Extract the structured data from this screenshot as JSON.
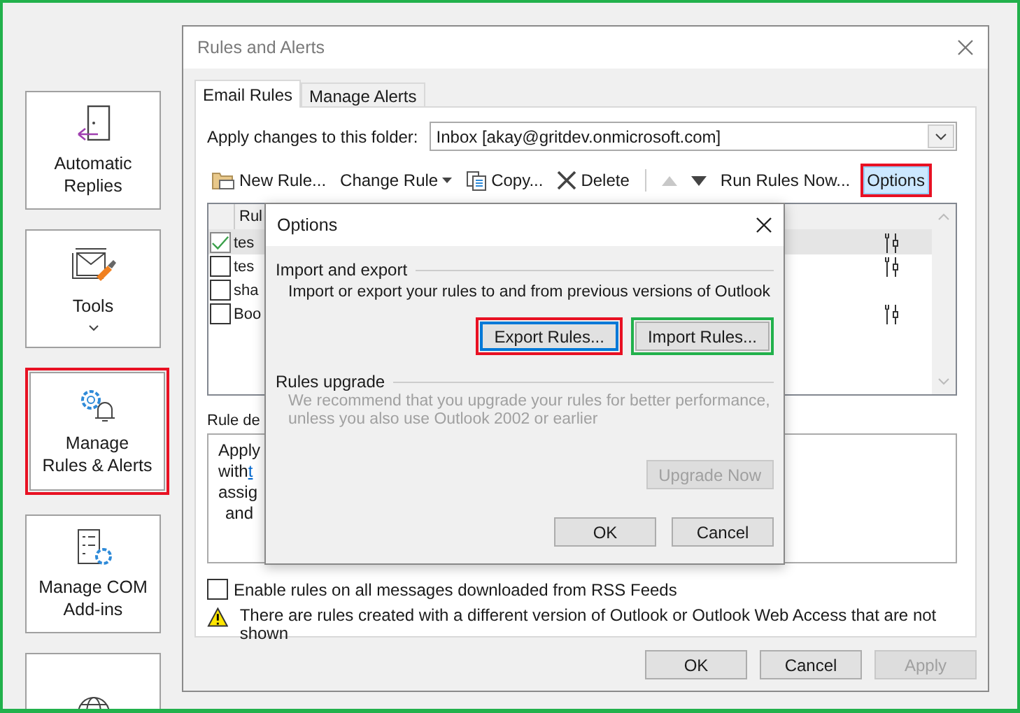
{
  "sidebar": {
    "items": [
      {
        "kind": "button",
        "label": "Automatic Replies"
      },
      {
        "kind": "dropdown",
        "label": "Tools"
      },
      {
        "kind": "button",
        "label": "Manage Rules & Alerts",
        "marked": true
      },
      {
        "kind": "button",
        "label": "Manage COM Add-ins"
      },
      {
        "kind": "button"
      }
    ]
  },
  "dialog": {
    "title": "Rules and Alerts",
    "tabs": [
      {
        "label": "Email Rules",
        "selected": true
      },
      {
        "label": "Manage Alerts",
        "selected": false
      }
    ],
    "folder": {
      "label": "Apply changes to this folder:",
      "value": "Inbox [akay@gritdev.onmicrosoft.com]"
    },
    "toolbar": [
      {
        "kind": "create",
        "label": "New Rule...",
        "selected": false,
        "disabled": false
      },
      {
        "kind": "menu",
        "label": "Change Rule",
        "selected": false,
        "disabled": false
      },
      {
        "kind": "copy",
        "label": "Copy...",
        "selected": false,
        "disabled": false
      },
      {
        "kind": "delete",
        "label": "Delete",
        "selected": false,
        "disabled": false
      },
      {
        "kind": "separator"
      },
      {
        "kind": "moveup",
        "selected": false,
        "disabled": true
      },
      {
        "kind": "movedown",
        "selected": false,
        "disabled": false
      },
      {
        "kind": "button",
        "label": "Run Rules Now...",
        "selected": false,
        "disabled": false
      },
      {
        "kind": "button",
        "label": "Options",
        "selected": true,
        "disabled": false,
        "marked": true
      }
    ],
    "rules": {
      "header": "Rul",
      "rows": [
        {
          "name": "tes",
          "checked": true,
          "selected": true,
          "tool_action": true
        },
        {
          "name": "tes",
          "checked": false,
          "selected": false,
          "tool_action": true
        },
        {
          "name": "sha",
          "checked": false,
          "selected": false,
          "tool_action": false
        },
        {
          "name": "Boo",
          "checked": false,
          "selected": false,
          "tool_action": true
        }
      ]
    },
    "description": {
      "label": "Rule de",
      "lines": [
        {
          "text": "Apply"
        },
        {
          "text": "with",
          "link": "t"
        },
        {
          "text": "assig"
        },
        {
          "text": "and"
        }
      ]
    },
    "rss": {
      "label": "Enable rules on all messages downloaded from RSS Feeds",
      "checked": false
    },
    "warning": "There are rules created with a different version of Outlook or Outlook Web Access that are not shown",
    "buttons": [
      {
        "label": "OK",
        "disabled": false
      },
      {
        "label": "Cancel",
        "disabled": false
      },
      {
        "label": "Apply",
        "disabled": true
      }
    ]
  },
  "options": {
    "title": "Options",
    "import_export": {
      "heading": "Import and export",
      "text": "Import or export your rules to and from previous versions of Outlook",
      "buttons": [
        {
          "label": "Export Rules...",
          "focused": true,
          "marked": true
        },
        {
          "label": "Import Rules...",
          "focused": false,
          "marked": true
        }
      ]
    },
    "upgrade": {
      "heading": "Rules upgrade",
      "lines": [
        "We recommend that you upgrade your rules for better performance,",
        "unless you also use Outlook 2002 or earlier"
      ],
      "disabled": true,
      "button": {
        "label": "Upgrade Now",
        "disabled": true
      }
    },
    "buttons": [
      {
        "label": "OK",
        "disabled": false
      },
      {
        "label": "Cancel",
        "disabled": false
      }
    ]
  }
}
